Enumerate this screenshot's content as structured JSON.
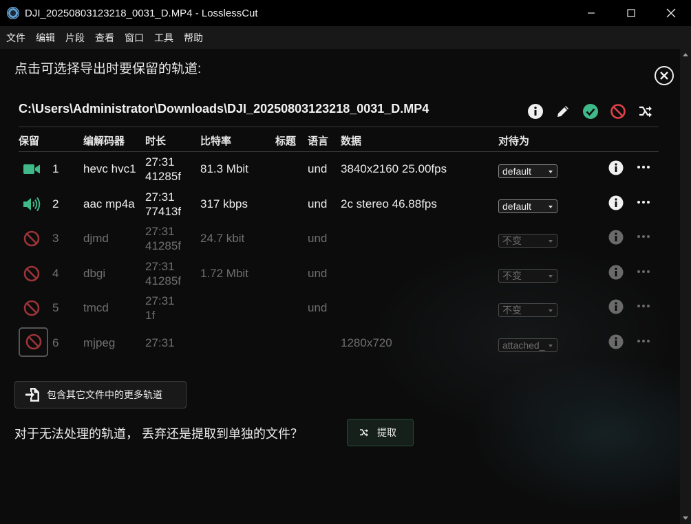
{
  "window": {
    "title": "DJI_20250803123218_0031_D.MP4 - LosslessCut"
  },
  "menu": [
    "文件",
    "编辑",
    "片段",
    "查看",
    "窗口",
    "工具",
    "帮助"
  ],
  "dialog": {
    "instruction": "点击可选择导出时要保留的轨道:",
    "file_path": "C:\\Users\\Administrator\\Downloads\\DJI_20250803123218_0031_D.MP4",
    "file_actions": [
      "info-icon",
      "edit-icon",
      "check-all-icon",
      "disable-all-icon",
      "extract-icon"
    ]
  },
  "table": {
    "headers": [
      "保留",
      "编解码器",
      "时长",
      "比特率",
      "标题",
      "语言",
      "数据",
      "对待为"
    ],
    "rows": [
      {
        "index": "1",
        "status": "video-icon",
        "enabled": true,
        "codec": "hevc hvc1",
        "dur1": "27:31",
        "dur2": "41285f",
        "bitrate": "81.3 Mbit",
        "title": "",
        "lang": "und",
        "data": "3840x2160 25.00fps",
        "treat": "default"
      },
      {
        "index": "2",
        "status": "audio-icon",
        "enabled": true,
        "codec": "aac mp4a",
        "dur1": "27:31",
        "dur2": "77413f",
        "bitrate": "317 kbps",
        "title": "",
        "lang": "und",
        "data": "2c stereo 46.88fps",
        "treat": "default"
      },
      {
        "index": "3",
        "status": "disabled-icon",
        "enabled": false,
        "codec": "djmd",
        "dur1": "27:31",
        "dur2": "41285f",
        "bitrate": "24.7 kbit",
        "title": "",
        "lang": "und",
        "data": "",
        "treat": "不变"
      },
      {
        "index": "4",
        "status": "disabled-icon",
        "enabled": false,
        "codec": "dbgi",
        "dur1": "27:31",
        "dur2": "41285f",
        "bitrate": "1.72 Mbit",
        "title": "",
        "lang": "und",
        "data": "",
        "treat": "不变"
      },
      {
        "index": "5",
        "status": "disabled-icon",
        "enabled": false,
        "codec": "tmcd",
        "dur1": "27:31",
        "dur2": "1f",
        "bitrate": "",
        "title": "",
        "lang": "und",
        "data": "",
        "treat": "不变"
      },
      {
        "index": "6",
        "status": "disabled-icon",
        "enabled": false,
        "codec": "mjpeg",
        "dur1": "27:31",
        "dur2": "",
        "bitrate": "",
        "title": "",
        "lang": "",
        "data": "1280x720",
        "treat": "attached_"
      }
    ]
  },
  "include_button": "包含其它文件中的更多轨道",
  "unprocessable_question": "对于无法处理的轨道， 丢弃还是提取到单独的文件？",
  "extract_button": "提取",
  "colors": {
    "accent_green": "#3fb98a",
    "disable_red": "#e0404a",
    "background": "#0c0c0c"
  }
}
